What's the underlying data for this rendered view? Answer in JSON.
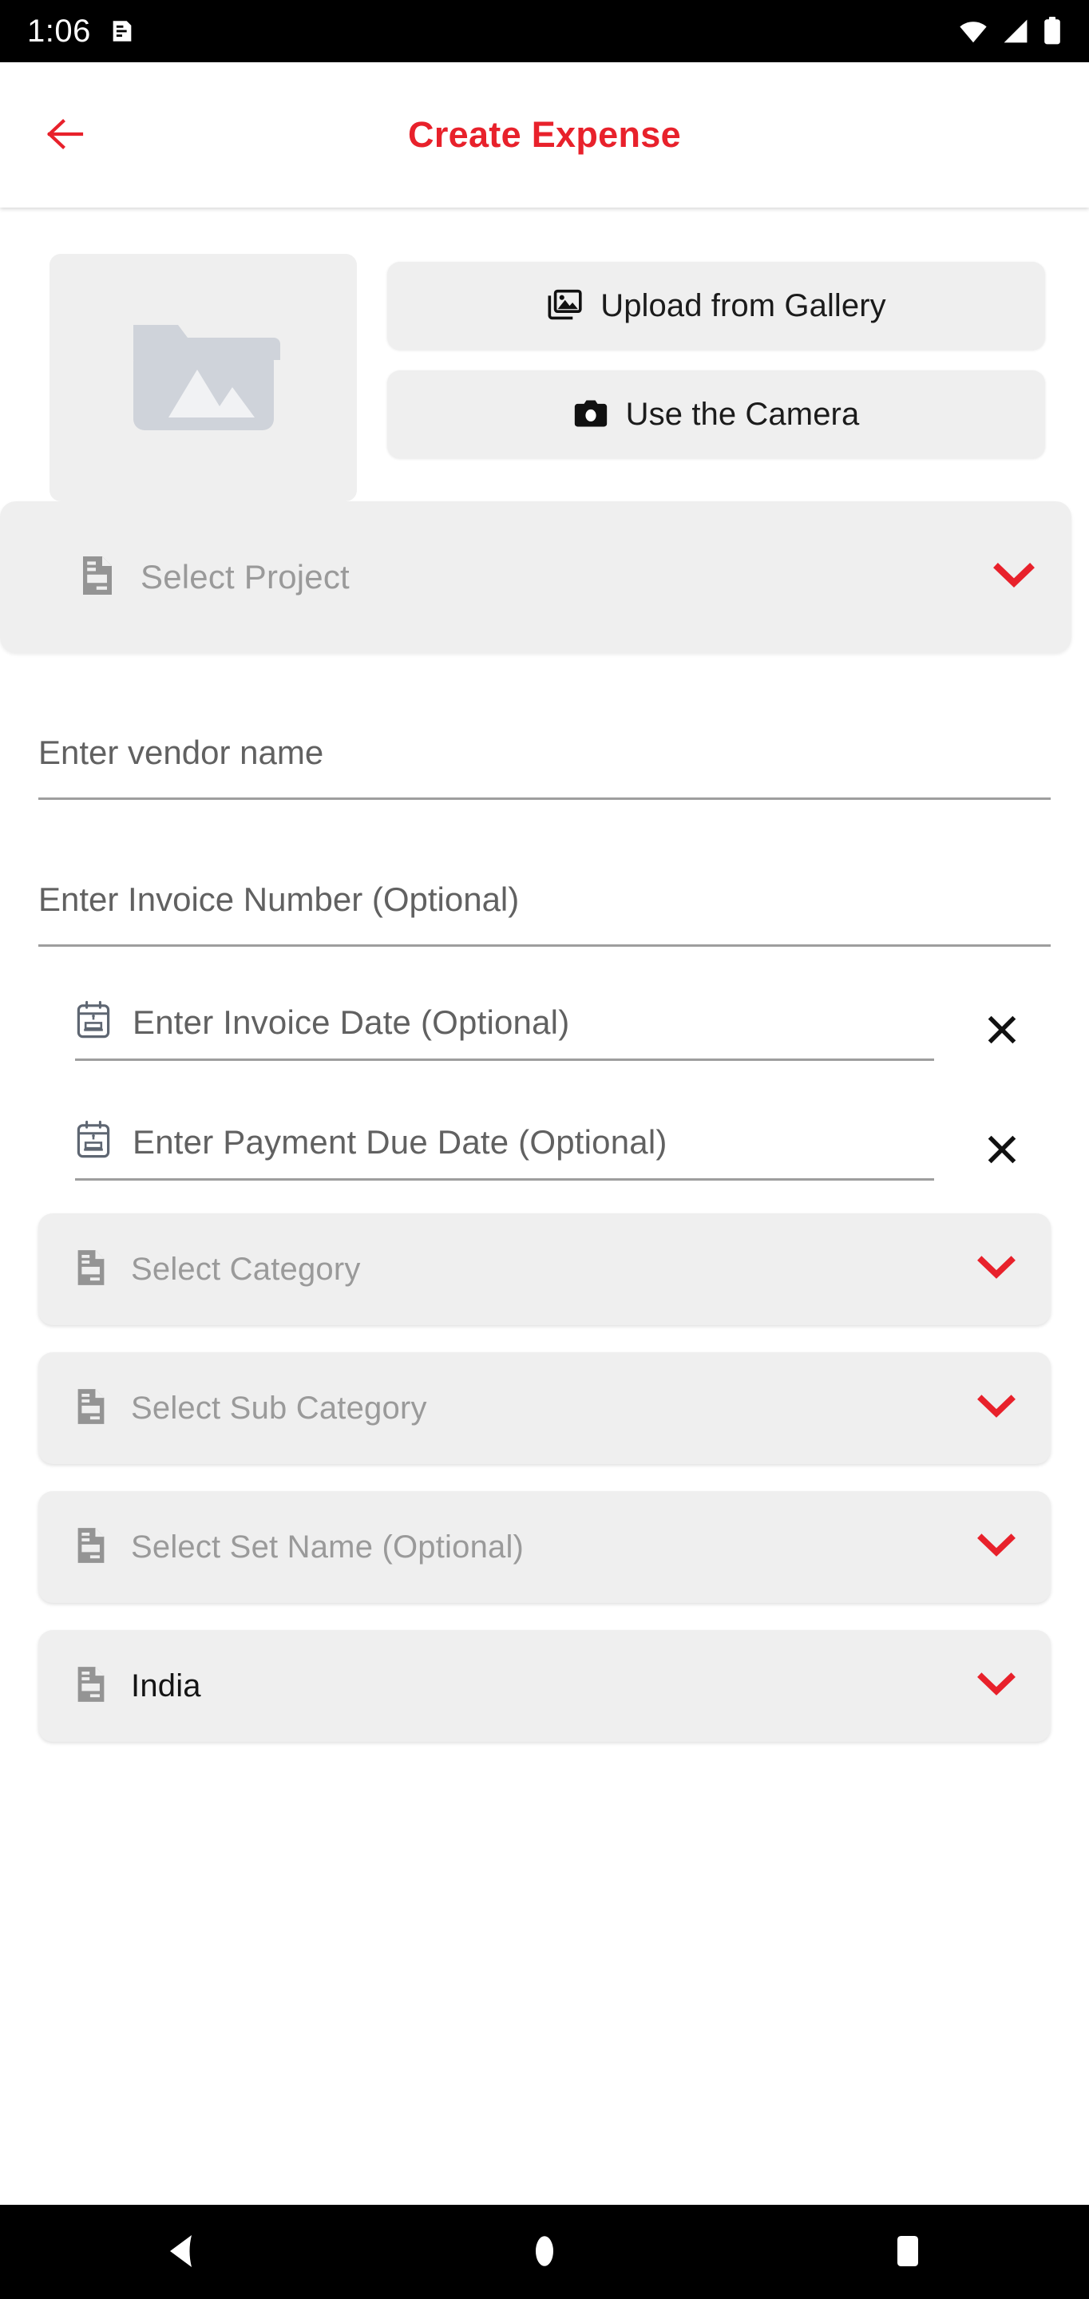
{
  "status_bar": {
    "time": "1:06",
    "icons": [
      "notification-icon",
      "wifi-icon",
      "cellular-signal-icon",
      "battery-icon"
    ]
  },
  "app_bar": {
    "title": "Create Expense",
    "back_icon": "back-arrow-icon",
    "title_color": "#E8212B"
  },
  "upload": {
    "placeholder_icon": "image-folder-placeholder-icon",
    "gallery_button": {
      "label": "Upload from Gallery",
      "icon": "photo-library-icon"
    },
    "camera_button": {
      "label": "Use the Camera",
      "icon": "camera-icon"
    }
  },
  "project": {
    "label": "Select Project",
    "icon": "document-icon",
    "chevron": "chevron-down-icon",
    "value": ""
  },
  "fields": [
    {
      "name": "vendor-name",
      "placeholder": "Enter vendor name",
      "value": ""
    },
    {
      "name": "invoice-number",
      "placeholder": "Enter Invoice Number (Optional)",
      "value": ""
    }
  ],
  "dates": [
    {
      "name": "invoice-date",
      "label": "Enter Invoice Date (Optional)",
      "icon": "calendar-event-icon",
      "clear_icon": "close-x-icon",
      "value": ""
    },
    {
      "name": "payment-due-date",
      "label": "Enter Payment Due Date (Optional)",
      "icon": "calendar-event-icon",
      "clear_icon": "close-x-icon",
      "value": ""
    }
  ],
  "dropdowns": [
    {
      "name": "category",
      "label": "Select Category",
      "icon": "document-icon",
      "chevron": "chevron-down-icon",
      "filled": false
    },
    {
      "name": "sub-category",
      "label": "Select Sub Category",
      "icon": "document-icon",
      "chevron": "chevron-down-icon",
      "filled": false
    },
    {
      "name": "set-name",
      "label": "Select Set Name (Optional)",
      "icon": "document-icon",
      "chevron": "chevron-down-icon",
      "filled": false
    },
    {
      "name": "country",
      "label": "India",
      "icon": "document-icon",
      "chevron": "chevron-down-icon",
      "filled": true
    }
  ],
  "nav_bar": {
    "back": "nav-back-icon",
    "home": "nav-home-icon",
    "recents": "nav-recents-icon"
  },
  "colors": {
    "accent_red": "#E8212B",
    "chevron_red": "#E8212B",
    "field_grey": "#EFEFEF",
    "placeholder_grey": "#9A9A9A",
    "underline_grey": "#9E9E9E"
  }
}
